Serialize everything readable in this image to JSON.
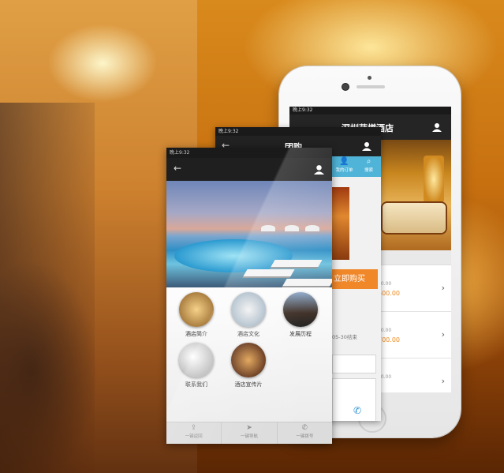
{
  "colors": {
    "accent_orange": "#f0882a",
    "price_orange": "#f08a1e",
    "tab_blue": "#4fb4d8",
    "nav_dark": "#222222"
  },
  "screen_main": {
    "status_time": "晚上9:32",
    "back_icon": "back-arrow-icon",
    "user_icon": "user-icon",
    "tiles": [
      {
        "label": "酒店简介"
      },
      {
        "label": "酒店文化"
      },
      {
        "label": "发展历程"
      },
      {
        "label": "联系我们"
      },
      {
        "label": "酒店宣传片"
      }
    ],
    "toolbar": [
      {
        "label": "一键返回",
        "icon": "share-icon"
      },
      {
        "label": "一键导航",
        "icon": "navigation-icon"
      },
      {
        "label": "一键拨号",
        "icon": "phone-icon"
      }
    ]
  },
  "screen_group": {
    "status_time": "晚上9:32",
    "title": "团购",
    "tabs": [
      {
        "label": "我的订单",
        "icon": "user-icon"
      },
      {
        "label": "搜索",
        "icon": "search-icon"
      }
    ],
    "buy_button": "立即购买",
    "date_text": "05-30结束"
  },
  "screen_hotel": {
    "status_time": "晚上9:32",
    "title": "深圳蓝樽酒店",
    "rows": [
      {
        "small": "00.00",
        "price": "500.00"
      },
      {
        "small": "00.00",
        "price": "700.00"
      },
      {
        "small": "00.00",
        "price": ""
      }
    ]
  }
}
